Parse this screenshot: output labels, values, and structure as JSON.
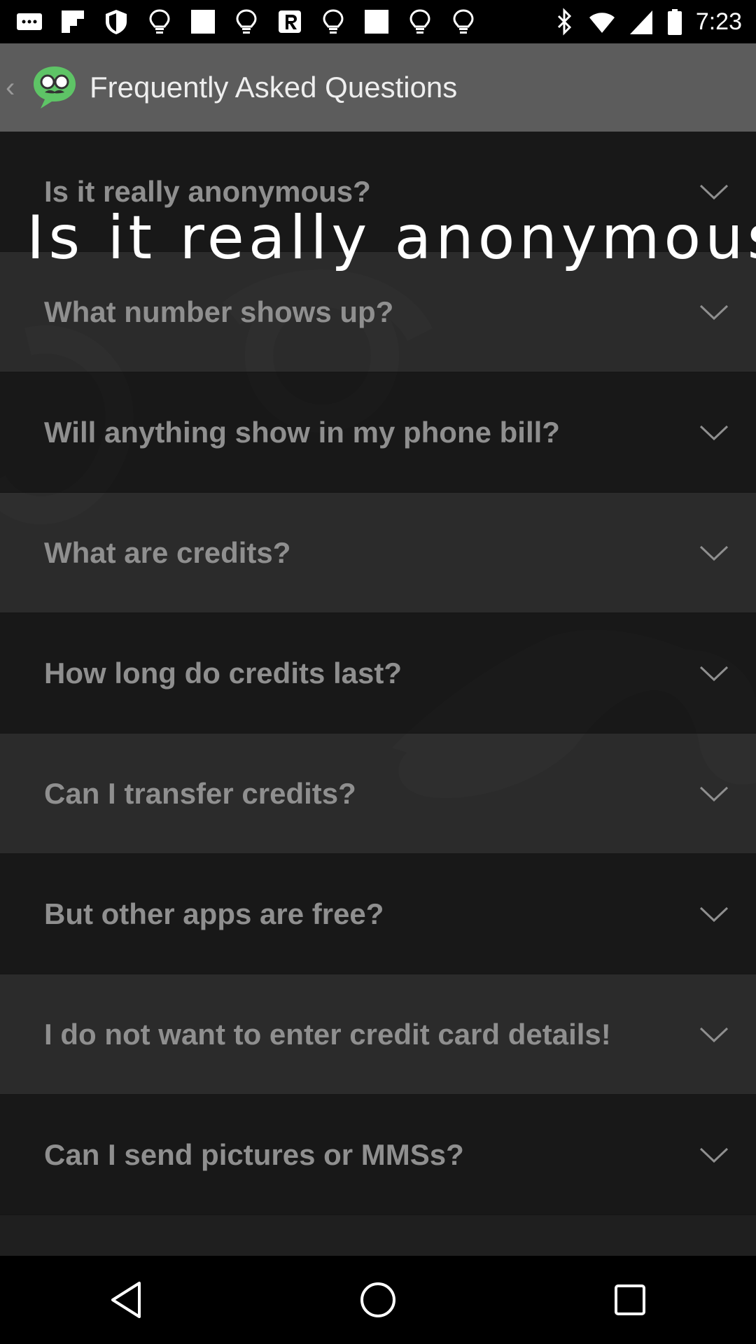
{
  "status_bar": {
    "time": "7:23"
  },
  "app_bar": {
    "title": "Frequently Asked Questions"
  },
  "overlay": {
    "text": "Is it really anonymous"
  },
  "faq": [
    {
      "question": "Is it really anonymous?"
    },
    {
      "question": "What number shows up?"
    },
    {
      "question": "Will anything show in my phone bill?"
    },
    {
      "question": "What are credits?"
    },
    {
      "question": "How long do credits last?"
    },
    {
      "question": "Can I transfer credits?"
    },
    {
      "question": "But other apps are free?"
    },
    {
      "question": "I do not want to enter credit card details!"
    },
    {
      "question": "Can I send pictures or MMSs?"
    }
  ],
  "colors": {
    "app_bar": "#5c5c5c",
    "list_bg": "#1f1f1f",
    "question_text": "#8f8f8f",
    "logo_green": "#5ec466"
  },
  "icons": {
    "nav": [
      "back-triangle-icon",
      "home-circle-icon",
      "recents-square-icon"
    ]
  }
}
